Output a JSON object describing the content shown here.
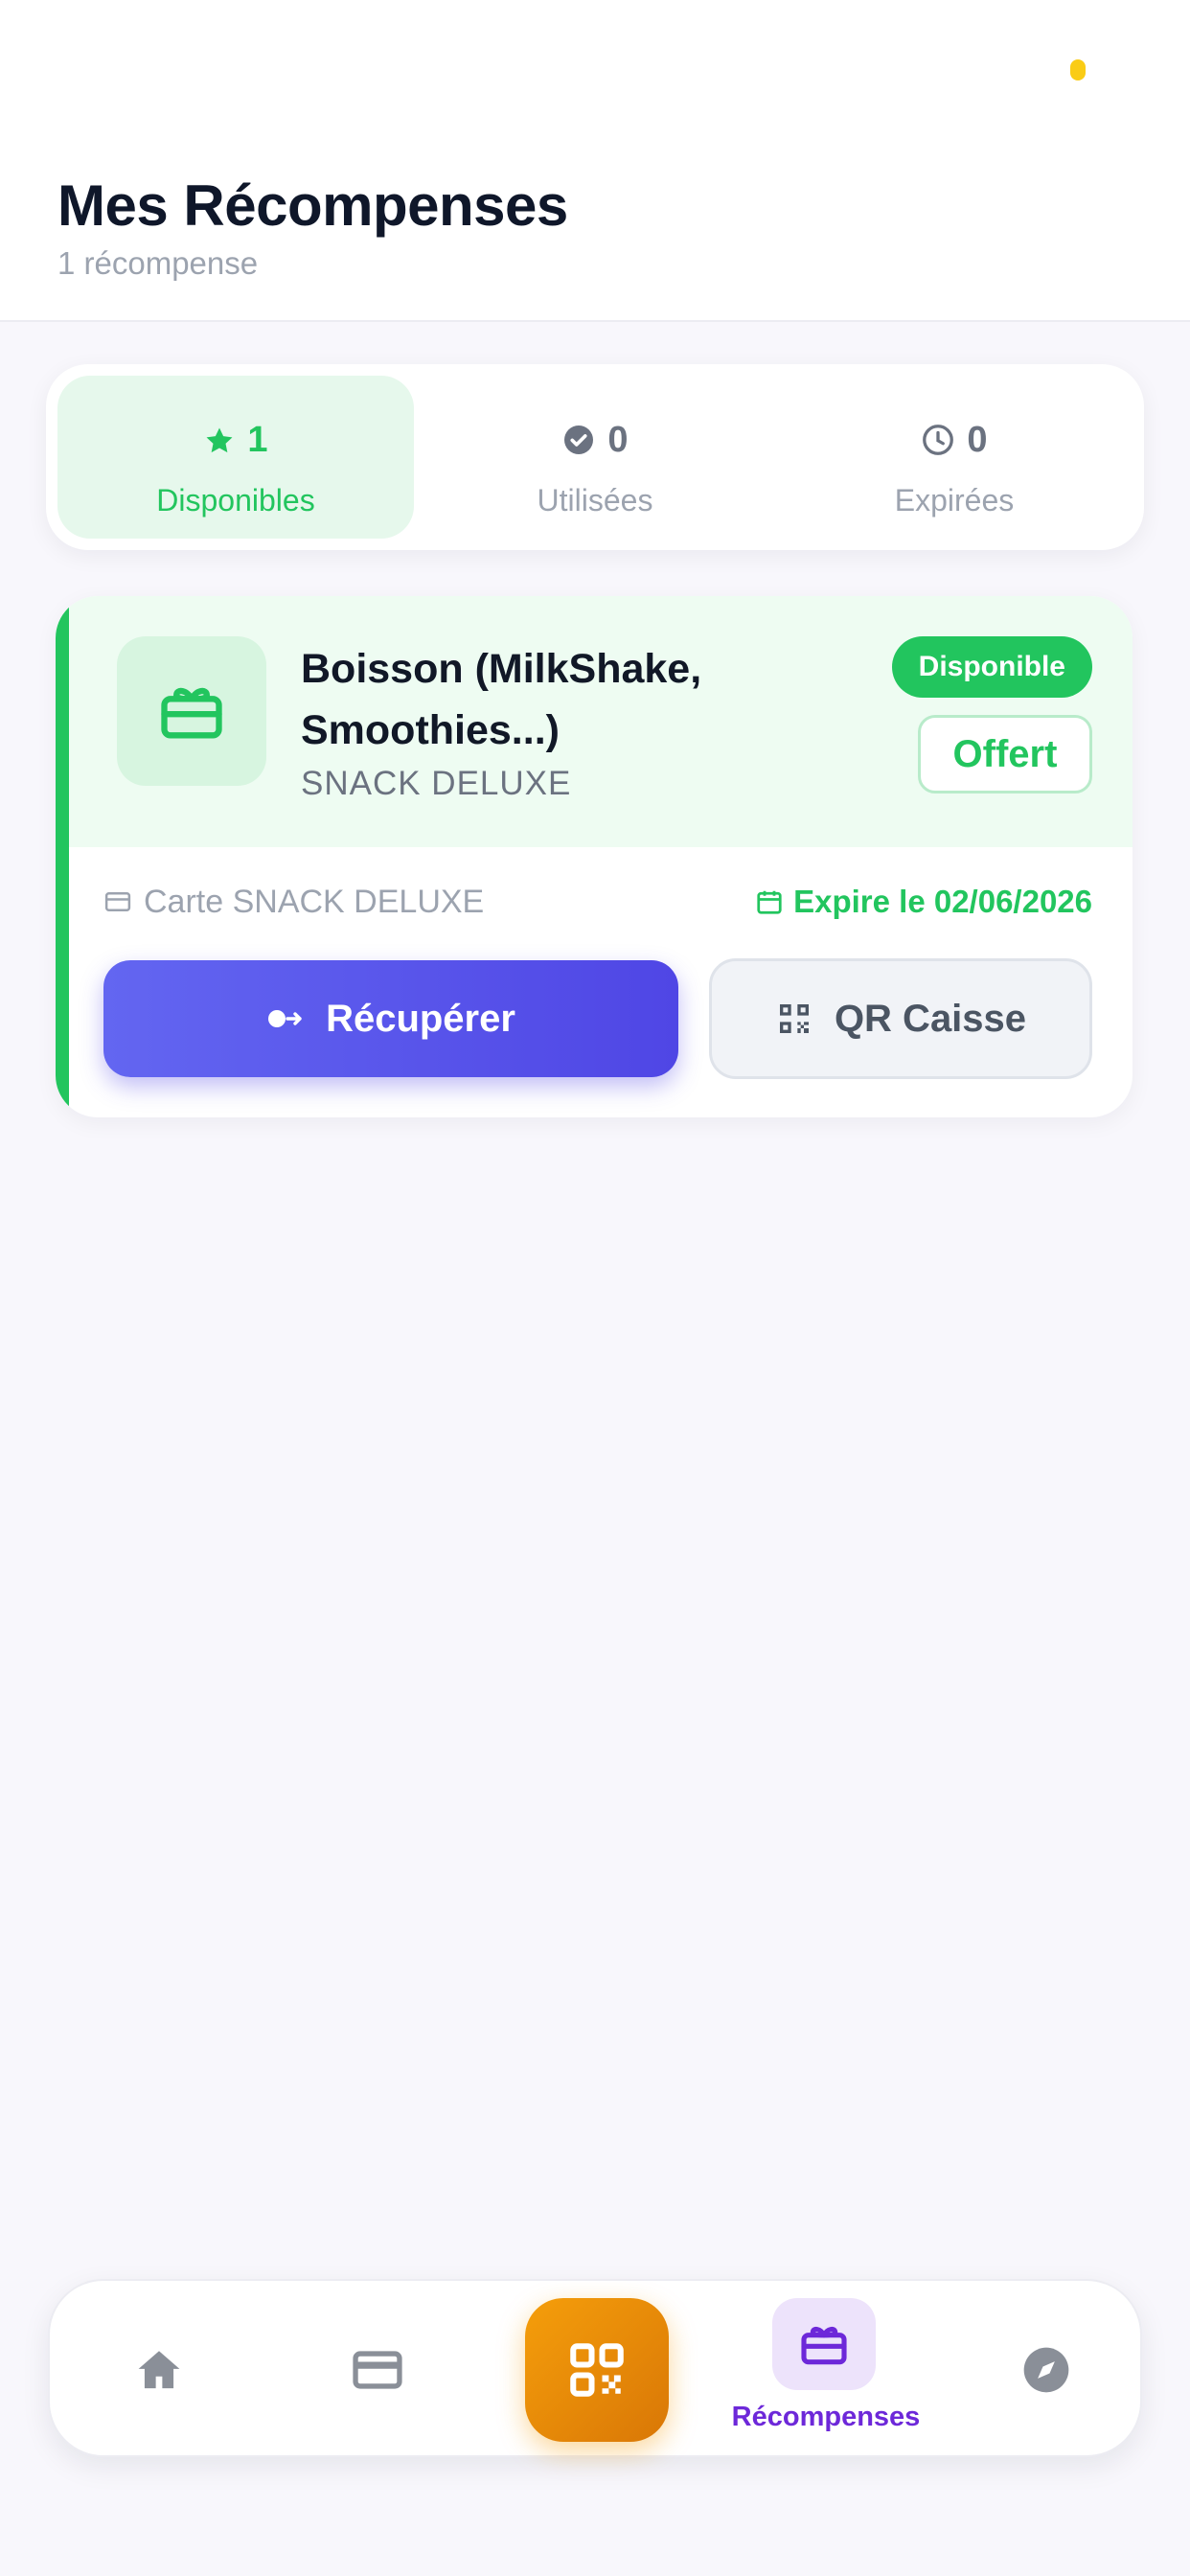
{
  "header": {
    "title": "Mes Récompenses",
    "subtitle": "1 récompense"
  },
  "tabs": [
    {
      "icon": "star-icon",
      "count": "1",
      "label": "Disponibles",
      "active": true
    },
    {
      "icon": "check-circle-icon",
      "count": "0",
      "label": "Utilisées",
      "active": false
    },
    {
      "icon": "clock-icon",
      "count": "0",
      "label": "Expirées",
      "active": false
    }
  ],
  "reward": {
    "icon": "gift-card-icon",
    "title": "Boisson (MilkShake, Smoothies...)",
    "merchant": "SNACK DELUXE",
    "status_badge": "Disponible",
    "value_badge": "Offert",
    "card_label": "Carte SNACK DELUXE",
    "expire_label": "Expire le 02/06/2026",
    "primary_button": "Récupérer",
    "secondary_button": "QR Caisse"
  },
  "bottom_nav": {
    "items": [
      {
        "icon": "home-icon"
      },
      {
        "icon": "credit-card-icon"
      },
      {
        "icon": "qr-scan-icon"
      },
      {
        "icon": "gift-card-icon",
        "label": "Récompenses",
        "active": true
      },
      {
        "icon": "compass-icon"
      }
    ]
  },
  "colors": {
    "accent_green": "#22c55e",
    "primary_indigo": "#4f46e5",
    "scan_orange": "#f59e0b",
    "nav_active_purple": "#6d28d9"
  }
}
